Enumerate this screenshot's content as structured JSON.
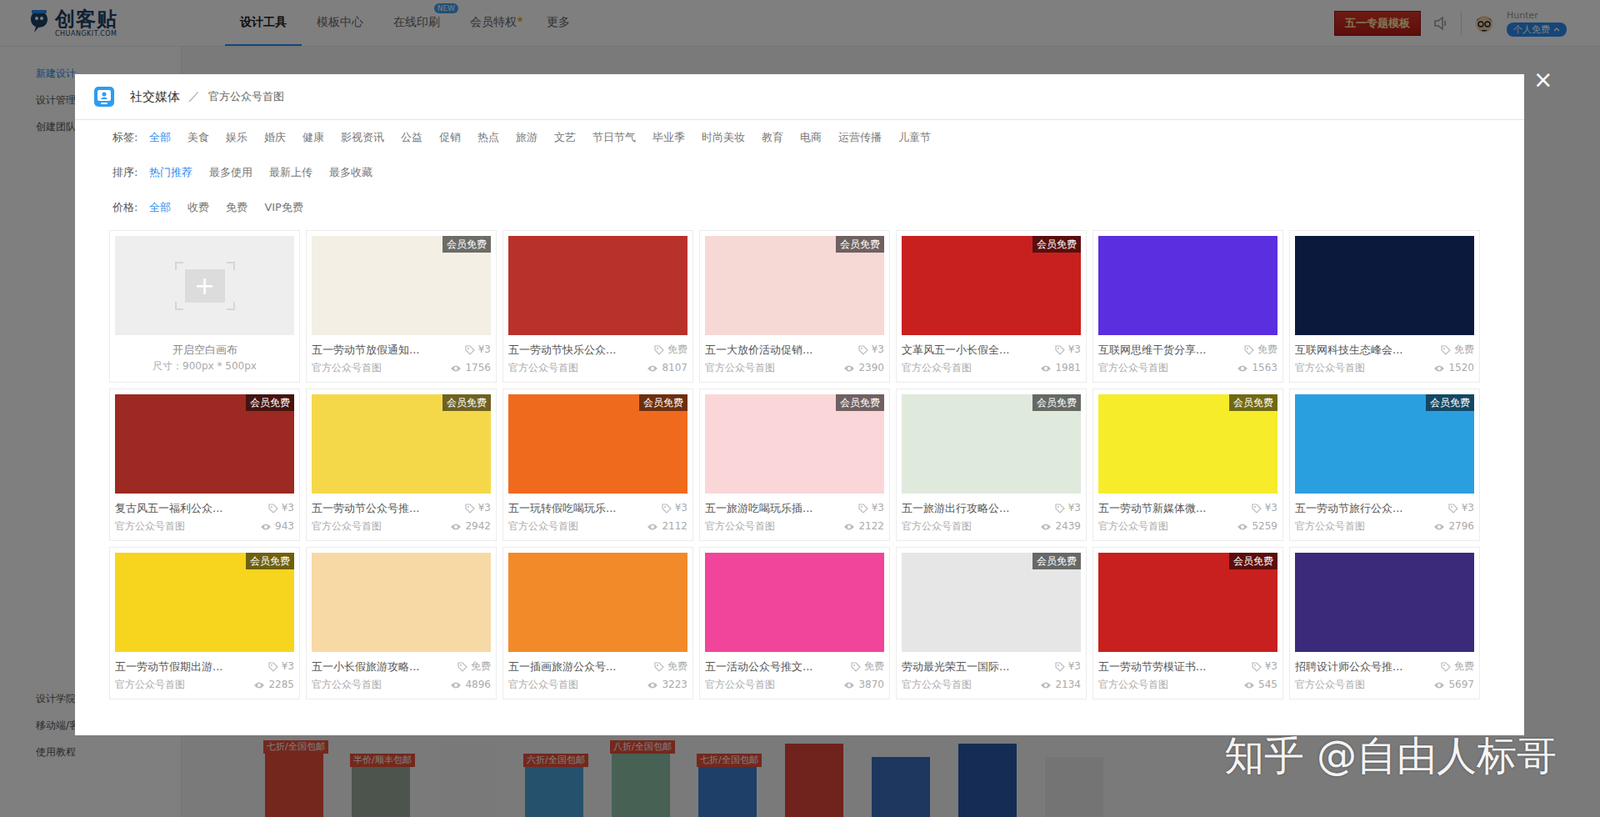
{
  "page": {
    "logo": {
      "name": "创客贴",
      "sub": "CHUANGKIT.COM"
    },
    "nav": [
      {
        "label": "设计工具",
        "selected": true,
        "badge": null,
        "starred": false
      },
      {
        "label": "模板中心",
        "selected": false,
        "badge": null,
        "starred": false
      },
      {
        "label": "在线印刷",
        "selected": false,
        "badge": "NEW",
        "starred": false
      },
      {
        "label": "会员特权",
        "selected": false,
        "badge": null,
        "starred": true
      },
      {
        "label": "更多",
        "selected": false,
        "badge": null,
        "starred": false
      }
    ],
    "banner": "五一专题模板",
    "user": {
      "name": "Hunter",
      "plan": "个人免费"
    },
    "sidebar_top": [
      {
        "label": "新建设计",
        "selected": true
      },
      {
        "label": "设计管理",
        "selected": false
      },
      {
        "label": "创建团队",
        "selected": false
      }
    ],
    "sidebar_bottom": [
      {
        "label": "设计学院",
        "selected": false
      },
      {
        "label": "移动端/客",
        "selected": false
      },
      {
        "label": "使用教程",
        "selected": false
      }
    ],
    "products": [
      {
        "label": "七折/全国包邮",
        "color": "#e8503a"
      },
      {
        "label": "半价/顺丰包邮",
        "color": "#9aa89a"
      },
      {
        "label": null,
        "color": "#f2f2f2"
      },
      {
        "label": "六折/全国包邮",
        "color": "#4aa3d8"
      },
      {
        "label": "八折/全国包邮",
        "color": "#8fc3a8"
      },
      {
        "label": "七折/全国包邮",
        "color": "#3a7fd0"
      },
      {
        "label": null,
        "color": "#e0453a"
      },
      {
        "label": null,
        "color": "#3a6fbf"
      },
      {
        "label": null,
        "color": "#2a5aa8"
      },
      {
        "label": null,
        "color": "#e8e8e8"
      }
    ]
  },
  "dialog": {
    "category": "社交媒体",
    "separator": "／",
    "subcategory": "官方公众号首图",
    "close": "×",
    "filters": [
      {
        "label": "标签:",
        "options": [
          {
            "label": "全部",
            "selected": true
          },
          {
            "label": "美食",
            "selected": false
          },
          {
            "label": "娱乐",
            "selected": false
          },
          {
            "label": "婚庆",
            "selected": false
          },
          {
            "label": "健康",
            "selected": false
          },
          {
            "label": "影视资讯",
            "selected": false
          },
          {
            "label": "公益",
            "selected": false
          },
          {
            "label": "促销",
            "selected": false
          },
          {
            "label": "热点",
            "selected": false
          },
          {
            "label": "旅游",
            "selected": false
          },
          {
            "label": "文艺",
            "selected": false
          },
          {
            "label": "节日节气",
            "selected": false
          },
          {
            "label": "毕业季",
            "selected": false
          },
          {
            "label": "时尚美妆",
            "selected": false
          },
          {
            "label": "教育",
            "selected": false
          },
          {
            "label": "电商",
            "selected": false
          },
          {
            "label": "运营传播",
            "selected": false
          },
          {
            "label": "儿童节",
            "selected": false
          }
        ]
      },
      {
        "label": "排序:",
        "options": [
          {
            "label": "热门推荐",
            "selected": true
          },
          {
            "label": "最多使用",
            "selected": false
          },
          {
            "label": "最新上传",
            "selected": false
          },
          {
            "label": "最多收藏",
            "selected": false
          }
        ]
      },
      {
        "label": "价格:",
        "options": [
          {
            "label": "全部",
            "selected": true
          },
          {
            "label": "收费",
            "selected": false
          },
          {
            "label": "免费",
            "selected": false
          },
          {
            "label": "VIP免费",
            "selected": false
          }
        ]
      }
    ],
    "blank_card": {
      "plus": "+",
      "title": "开启空白画布",
      "size": "尺寸：900px * 500px"
    },
    "templates": [
      {
        "title": "五一劳动节放假通知...",
        "price": "¥3",
        "category": "官方公众号首图",
        "views": "1756",
        "badge": "会员免费",
        "color": "#f4efe4"
      },
      {
        "title": "五一劳动节快乐公众...",
        "price": "免费",
        "category": "官方公众号首图",
        "views": "8107",
        "badge": null,
        "color": "#b8322b"
      },
      {
        "title": "五一大放价活动促销...",
        "price": "¥3",
        "category": "官方公众号首图",
        "views": "2390",
        "badge": "会员免费",
        "color": "#f6d8d4"
      },
      {
        "title": "文革风五一小长假全...",
        "price": "¥3",
        "category": "官方公众号首图",
        "views": "1981",
        "badge": "会员免费",
        "color": "#c8201e"
      },
      {
        "title": "互联网思维干货分享...",
        "price": "免费",
        "category": "官方公众号首图",
        "views": "1563",
        "badge": null,
        "color": "#5b2ee0"
      },
      {
        "title": "互联网科技生态峰会...",
        "price": "免费",
        "category": "官方公众号首图",
        "views": "1520",
        "badge": null,
        "color": "#0b1a3c"
      },
      {
        "title": "复古风五一福利公众...",
        "price": "¥3",
        "category": "官方公众号首图",
        "views": "943",
        "badge": "会员免费",
        "color": "#9c2a22"
      },
      {
        "title": "五一劳动节公众号推...",
        "price": "¥3",
        "category": "官方公众号首图",
        "views": "2942",
        "badge": "会员免费",
        "color": "#f5d84a"
      },
      {
        "title": "五一玩转假吃喝玩乐...",
        "price": "¥3",
        "category": "官方公众号首图",
        "views": "2112",
        "badge": "会员免费",
        "color": "#f06a1e"
      },
      {
        "title": "五一旅游吃喝玩乐插...",
        "price": "¥3",
        "category": "官方公众号首图",
        "views": "2122",
        "badge": "会员免费",
        "color": "#fbd6d8"
      },
      {
        "title": "五一旅游出行攻略公...",
        "price": "¥3",
        "category": "官方公众号首图",
        "views": "2439",
        "badge": "会员免费",
        "color": "#dfe9dc"
      },
      {
        "title": "五一劳动节新媒体微...",
        "price": "¥3",
        "category": "官方公众号首图",
        "views": "5259",
        "badge": "会员免费",
        "color": "#f7ec2a"
      },
      {
        "title": "五一劳动节旅行公众...",
        "price": "¥3",
        "category": "官方公众号首图",
        "views": "2796",
        "badge": "会员免费",
        "color": "#2a9fe0"
      },
      {
        "title": "五一劳动节假期出游...",
        "price": "¥3",
        "category": "官方公众号首图",
        "views": "2285",
        "badge": "会员免费",
        "color": "#f7d51e"
      },
      {
        "title": "五一小长假旅游攻略...",
        "price": "免费",
        "category": "官方公众号首图",
        "views": "4896",
        "badge": null,
        "color": "#f7d9a6"
      },
      {
        "title": "五一插画旅游公众号...",
        "price": "免费",
        "category": "官方公众号首图",
        "views": "3223",
        "badge": null,
        "color": "#f28a2a"
      },
      {
        "title": "五一活动公众号推文...",
        "price": "免费",
        "category": "官方公众号首图",
        "views": "3870",
        "badge": null,
        "color": "#f0459a"
      },
      {
        "title": "劳动最光荣五一国际...",
        "price": "¥3",
        "category": "官方公众号首图",
        "views": "2134",
        "badge": "会员免费",
        "color": "#e6e6e6"
      },
      {
        "title": "五一劳动节劳模证书...",
        "price": "¥3",
        "category": "官方公众号首图",
        "views": "545",
        "badge": "会员免费",
        "color": "#c8201e"
      },
      {
        "title": "招聘设计师公众号推...",
        "price": "免费",
        "category": "官方公众号首图",
        "views": "5697",
        "badge": null,
        "color": "#3b2a7a"
      }
    ]
  },
  "watermark": "知乎 @自由人标哥"
}
